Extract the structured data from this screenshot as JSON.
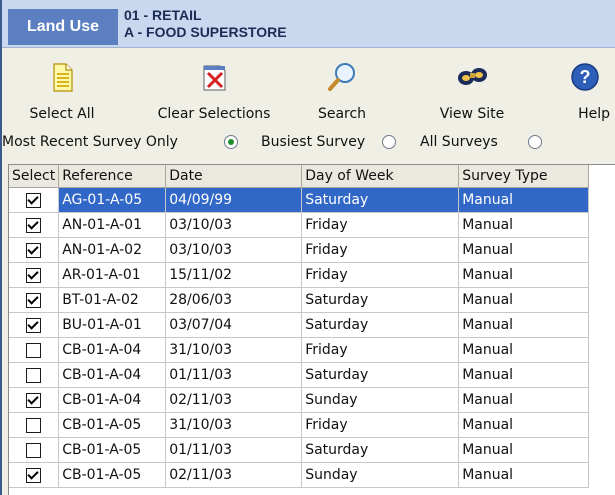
{
  "header": {
    "badge": "Land Use",
    "line1": "01 - RETAIL",
    "line2": "A - FOOD SUPERSTORE"
  },
  "toolbar": {
    "select_all": "Select All",
    "clear_selections": "Clear Selections",
    "search": "Search",
    "view_site": "View Site",
    "help": "Help"
  },
  "survey_filter": {
    "most_recent": "Most Recent Survey Only",
    "busiest": "Busiest Survey",
    "all": "All Surveys",
    "selected": "most_recent"
  },
  "table": {
    "columns": [
      "Select",
      "Reference",
      "Date",
      "Day of Week",
      "Survey Type"
    ],
    "rows": [
      {
        "checked": true,
        "reference": "AG-01-A-05",
        "date": "04/09/99",
        "day": "Saturday",
        "type": "Manual",
        "selected": true
      },
      {
        "checked": true,
        "reference": "AN-01-A-01",
        "date": "03/10/03",
        "day": "Friday",
        "type": "Manual"
      },
      {
        "checked": true,
        "reference": "AN-01-A-02",
        "date": "03/10/03",
        "day": "Friday",
        "type": "Manual"
      },
      {
        "checked": true,
        "reference": "AR-01-A-01",
        "date": "15/11/02",
        "day": "Friday",
        "type": "Manual"
      },
      {
        "checked": true,
        "reference": "BT-01-A-02",
        "date": "28/06/03",
        "day": "Saturday",
        "type": "Manual"
      },
      {
        "checked": true,
        "reference": "BU-01-A-01",
        "date": "03/07/04",
        "day": "Saturday",
        "type": "Manual"
      },
      {
        "checked": false,
        "reference": "CB-01-A-04",
        "date": "31/10/03",
        "day": "Friday",
        "type": "Manual"
      },
      {
        "checked": false,
        "reference": "CB-01-A-04",
        "date": "01/11/03",
        "day": "Saturday",
        "type": "Manual"
      },
      {
        "checked": true,
        "reference": "CB-01-A-04",
        "date": "02/11/03",
        "day": "Sunday",
        "type": "Manual"
      },
      {
        "checked": false,
        "reference": "CB-01-A-05",
        "date": "31/10/03",
        "day": "Friday",
        "type": "Manual"
      },
      {
        "checked": false,
        "reference": "CB-01-A-05",
        "date": "01/11/03",
        "day": "Saturday",
        "type": "Manual"
      },
      {
        "checked": true,
        "reference": "CB-01-A-05",
        "date": "02/11/03",
        "day": "Sunday",
        "type": "Manual"
      }
    ]
  },
  "colors": {
    "selection": "#3167c6",
    "header_band": "#c9d8ef",
    "badge": "#5b7fc0",
    "radio_dot": "#1c8f2a"
  },
  "icons": {
    "select_all": "document-icon",
    "clear_selections": "clear-document-icon",
    "search": "magnifier-icon",
    "view_site": "binoculars-icon",
    "help": "help-icon"
  }
}
